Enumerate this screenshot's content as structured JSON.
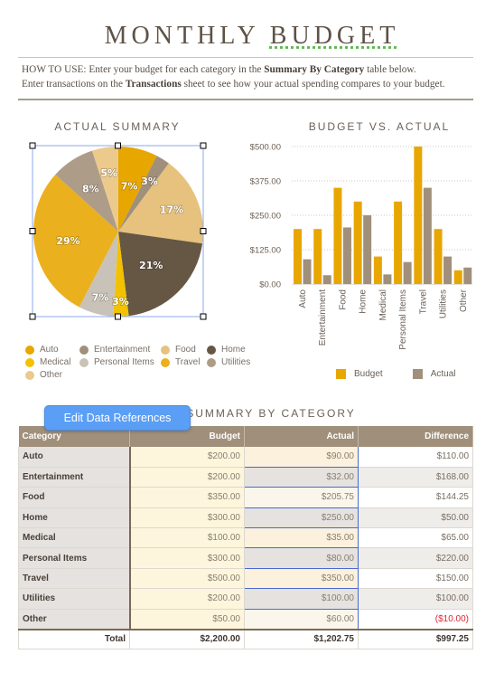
{
  "header": {
    "title_part1": "MONTHLY ",
    "title_part2": "BUDGET",
    "howto_prefix": "HOW TO USE: Enter your budget for each category in the ",
    "howto_bold1": "Summary By Category",
    "howto_mid": " table below.",
    "howto_line2_prefix": "Enter transactions on the ",
    "howto_bold2": "Transactions",
    "howto_line2_suffix": " sheet to see how your actual spending compares to your budget."
  },
  "colors": {
    "auto": "#e8a600",
    "entertainment": "#a08f7a",
    "food": "#e6c27e",
    "home": "#665744",
    "medical": "#f2c200",
    "personal_items": "#c9c2b8",
    "travel": "#ebb01e",
    "utilities": "#ad9d88",
    "other": "#ebca8c",
    "budget": "#e8a600",
    "actual": "#a08f7a"
  },
  "chart_data": [
    {
      "type": "pie",
      "title": "ACTUAL SUMMARY",
      "categories": [
        "Auto",
        "Entertainment",
        "Food",
        "Home",
        "Medical",
        "Personal Items",
        "Travel",
        "Utilities",
        "Other"
      ],
      "values": [
        90.0,
        32.0,
        205.75,
        250.0,
        35.0,
        80.0,
        350.0,
        100.0,
        60.0
      ],
      "labels": [
        "7%",
        "3%",
        "17%",
        "21%",
        "3%",
        "7%",
        "29%",
        "8%",
        "5%"
      ],
      "colors": [
        "#e8a600",
        "#a08f7a",
        "#e6c27e",
        "#665744",
        "#f2c200",
        "#c9c2b8",
        "#ebb01e",
        "#ad9d88",
        "#ebca8c"
      ],
      "legend_position": "bottom"
    },
    {
      "type": "bar",
      "title": "BUDGET VS. ACTUAL",
      "categories": [
        "Auto",
        "Entertainment",
        "Food",
        "Home",
        "Medical",
        "Personal Items",
        "Travel",
        "Utilities",
        "Other"
      ],
      "series": [
        {
          "name": "Budget",
          "values": [
            200,
            200,
            350,
            300,
            100,
            300,
            500,
            200,
            50
          ],
          "color": "#e8a600"
        },
        {
          "name": "Actual",
          "values": [
            90,
            32,
            205.75,
            250,
            35,
            80,
            350,
            100,
            60
          ],
          "color": "#a08f7a"
        }
      ],
      "yticks": [
        "$0.00",
        "$125.00",
        "$250.00",
        "$375.00",
        "$500.00"
      ],
      "ylim": [
        0,
        500
      ],
      "grid": true,
      "legend_position": "bottom"
    }
  ],
  "table": {
    "title": "SUMMARY BY CATEGORY",
    "headers": [
      "Category",
      "Budget",
      "Actual",
      "Difference"
    ],
    "rows": [
      {
        "category": "Auto",
        "budget": "$200.00",
        "actual": "$90.00",
        "difference": "$110.00"
      },
      {
        "category": "Entertainment",
        "budget": "$200.00",
        "actual": "$32.00",
        "difference": "$168.00"
      },
      {
        "category": "Food",
        "budget": "$350.00",
        "actual": "$205.75",
        "difference": "$144.25"
      },
      {
        "category": "Home",
        "budget": "$300.00",
        "actual": "$250.00",
        "difference": "$50.00"
      },
      {
        "category": "Medical",
        "budget": "$100.00",
        "actual": "$35.00",
        "difference": "$65.00"
      },
      {
        "category": "Personal Items",
        "budget": "$300.00",
        "actual": "$80.00",
        "difference": "$220.00"
      },
      {
        "category": "Travel",
        "budget": "$500.00",
        "actual": "$350.00",
        "difference": "$150.00"
      },
      {
        "category": "Utilities",
        "budget": "$200.00",
        "actual": "$100.00",
        "difference": "$100.00"
      },
      {
        "category": "Other",
        "budget": "$50.00",
        "actual": "$60.00",
        "difference": "($10.00)"
      }
    ],
    "total": {
      "label": "Total",
      "budget": "$2,200.00",
      "actual": "$1,202.75",
      "difference": "$997.25"
    }
  },
  "popup": {
    "edit_refs_label": "Edit Data References"
  }
}
